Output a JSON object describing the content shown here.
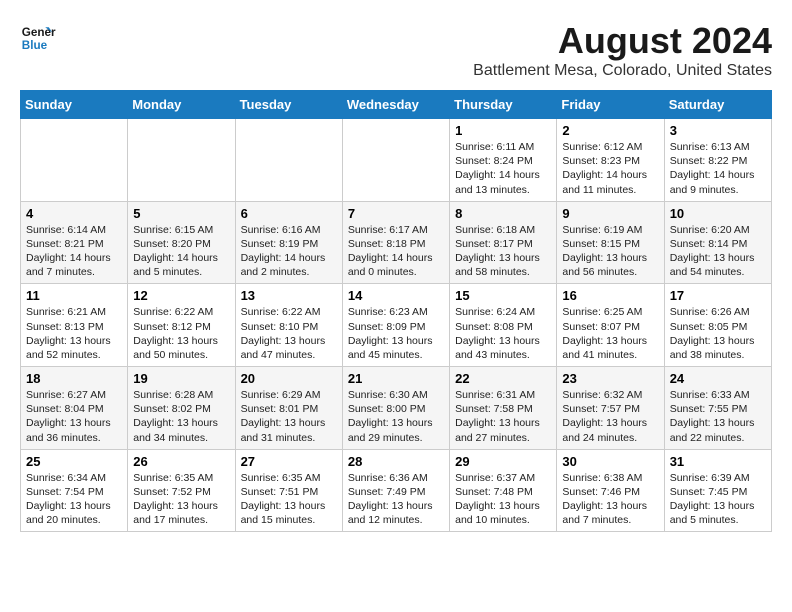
{
  "header": {
    "logo_line1": "General",
    "logo_line2": "Blue",
    "month_year": "August 2024",
    "location": "Battlement Mesa, Colorado, United States"
  },
  "weekdays": [
    "Sunday",
    "Monday",
    "Tuesday",
    "Wednesday",
    "Thursday",
    "Friday",
    "Saturday"
  ],
  "weeks": [
    [
      {
        "day": "",
        "info": ""
      },
      {
        "day": "",
        "info": ""
      },
      {
        "day": "",
        "info": ""
      },
      {
        "day": "",
        "info": ""
      },
      {
        "day": "1",
        "info": "Sunrise: 6:11 AM\nSunset: 8:24 PM\nDaylight: 14 hours\nand 13 minutes."
      },
      {
        "day": "2",
        "info": "Sunrise: 6:12 AM\nSunset: 8:23 PM\nDaylight: 14 hours\nand 11 minutes."
      },
      {
        "day": "3",
        "info": "Sunrise: 6:13 AM\nSunset: 8:22 PM\nDaylight: 14 hours\nand 9 minutes."
      }
    ],
    [
      {
        "day": "4",
        "info": "Sunrise: 6:14 AM\nSunset: 8:21 PM\nDaylight: 14 hours\nand 7 minutes."
      },
      {
        "day": "5",
        "info": "Sunrise: 6:15 AM\nSunset: 8:20 PM\nDaylight: 14 hours\nand 5 minutes."
      },
      {
        "day": "6",
        "info": "Sunrise: 6:16 AM\nSunset: 8:19 PM\nDaylight: 14 hours\nand 2 minutes."
      },
      {
        "day": "7",
        "info": "Sunrise: 6:17 AM\nSunset: 8:18 PM\nDaylight: 14 hours\nand 0 minutes."
      },
      {
        "day": "8",
        "info": "Sunrise: 6:18 AM\nSunset: 8:17 PM\nDaylight: 13 hours\nand 58 minutes."
      },
      {
        "day": "9",
        "info": "Sunrise: 6:19 AM\nSunset: 8:15 PM\nDaylight: 13 hours\nand 56 minutes."
      },
      {
        "day": "10",
        "info": "Sunrise: 6:20 AM\nSunset: 8:14 PM\nDaylight: 13 hours\nand 54 minutes."
      }
    ],
    [
      {
        "day": "11",
        "info": "Sunrise: 6:21 AM\nSunset: 8:13 PM\nDaylight: 13 hours\nand 52 minutes."
      },
      {
        "day": "12",
        "info": "Sunrise: 6:22 AM\nSunset: 8:12 PM\nDaylight: 13 hours\nand 50 minutes."
      },
      {
        "day": "13",
        "info": "Sunrise: 6:22 AM\nSunset: 8:10 PM\nDaylight: 13 hours\nand 47 minutes."
      },
      {
        "day": "14",
        "info": "Sunrise: 6:23 AM\nSunset: 8:09 PM\nDaylight: 13 hours\nand 45 minutes."
      },
      {
        "day": "15",
        "info": "Sunrise: 6:24 AM\nSunset: 8:08 PM\nDaylight: 13 hours\nand 43 minutes."
      },
      {
        "day": "16",
        "info": "Sunrise: 6:25 AM\nSunset: 8:07 PM\nDaylight: 13 hours\nand 41 minutes."
      },
      {
        "day": "17",
        "info": "Sunrise: 6:26 AM\nSunset: 8:05 PM\nDaylight: 13 hours\nand 38 minutes."
      }
    ],
    [
      {
        "day": "18",
        "info": "Sunrise: 6:27 AM\nSunset: 8:04 PM\nDaylight: 13 hours\nand 36 minutes."
      },
      {
        "day": "19",
        "info": "Sunrise: 6:28 AM\nSunset: 8:02 PM\nDaylight: 13 hours\nand 34 minutes."
      },
      {
        "day": "20",
        "info": "Sunrise: 6:29 AM\nSunset: 8:01 PM\nDaylight: 13 hours\nand 31 minutes."
      },
      {
        "day": "21",
        "info": "Sunrise: 6:30 AM\nSunset: 8:00 PM\nDaylight: 13 hours\nand 29 minutes."
      },
      {
        "day": "22",
        "info": "Sunrise: 6:31 AM\nSunset: 7:58 PM\nDaylight: 13 hours\nand 27 minutes."
      },
      {
        "day": "23",
        "info": "Sunrise: 6:32 AM\nSunset: 7:57 PM\nDaylight: 13 hours\nand 24 minutes."
      },
      {
        "day": "24",
        "info": "Sunrise: 6:33 AM\nSunset: 7:55 PM\nDaylight: 13 hours\nand 22 minutes."
      }
    ],
    [
      {
        "day": "25",
        "info": "Sunrise: 6:34 AM\nSunset: 7:54 PM\nDaylight: 13 hours\nand 20 minutes."
      },
      {
        "day": "26",
        "info": "Sunrise: 6:35 AM\nSunset: 7:52 PM\nDaylight: 13 hours\nand 17 minutes."
      },
      {
        "day": "27",
        "info": "Sunrise: 6:35 AM\nSunset: 7:51 PM\nDaylight: 13 hours\nand 15 minutes."
      },
      {
        "day": "28",
        "info": "Sunrise: 6:36 AM\nSunset: 7:49 PM\nDaylight: 13 hours\nand 12 minutes."
      },
      {
        "day": "29",
        "info": "Sunrise: 6:37 AM\nSunset: 7:48 PM\nDaylight: 13 hours\nand 10 minutes."
      },
      {
        "day": "30",
        "info": "Sunrise: 6:38 AM\nSunset: 7:46 PM\nDaylight: 13 hours\nand 7 minutes."
      },
      {
        "day": "31",
        "info": "Sunrise: 6:39 AM\nSunset: 7:45 PM\nDaylight: 13 hours\nand 5 minutes."
      }
    ]
  ]
}
